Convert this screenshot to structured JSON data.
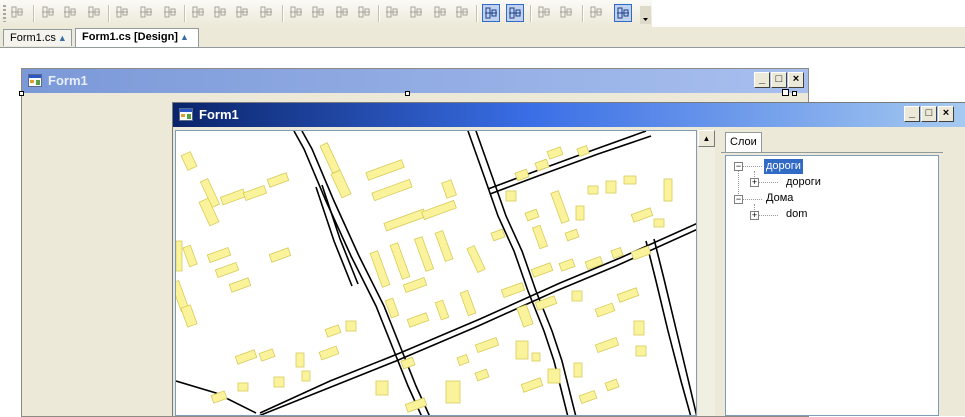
{
  "tabs": [
    {
      "label": "Form1.cs"
    },
    {
      "label": "Form1.cs [Design]"
    }
  ],
  "outer_form": {
    "title": "Form1"
  },
  "inner_form": {
    "title": "Form1"
  },
  "title_buttons": {
    "minimize": "_",
    "maximize": "□",
    "close": "×"
  },
  "layers_panel": {
    "tab_label": "Слои",
    "tree": [
      {
        "label": "дороги",
        "selected": true,
        "expanded": true,
        "children": [
          {
            "label": "дороги",
            "expanded": false
          }
        ]
      },
      {
        "label": "Дома",
        "selected": false,
        "expanded": true,
        "children": [
          {
            "label": "dom",
            "expanded": false
          }
        ]
      }
    ]
  },
  "colors": {
    "building": "#fbf39b",
    "building_outline": "#d8cc5a",
    "road": "#000000",
    "active_caption": "#0a246a",
    "inactive_caption": "#7b98d8",
    "selection": "#316ac5"
  },
  "toolbar_icons": [
    "align-to-grid-icon",
    "align-lefts-icon",
    "align-centers-icon",
    "align-rights-icon",
    "align-tops-icon",
    "align-middles-icon",
    "align-bottoms-icon",
    "make-same-width-icon",
    "make-same-height-icon",
    "make-same-size-icon",
    "size-to-grid-icon",
    "horizontal-spacing-equal-icon",
    "increase-horizontal-spacing-icon",
    "decrease-horizontal-spacing-icon",
    "remove-horizontal-spacing-icon",
    "vertical-spacing-equal-icon",
    "increase-vertical-spacing-icon",
    "decrease-vertical-spacing-icon",
    "remove-vertical-spacing-icon",
    "center-horizontally-icon",
    "center-vertically-icon",
    "bring-to-front-icon",
    "send-to-back-icon",
    "lock-controls-icon",
    "tab-order-icon",
    "toolbar-overflow-icon"
  ]
}
